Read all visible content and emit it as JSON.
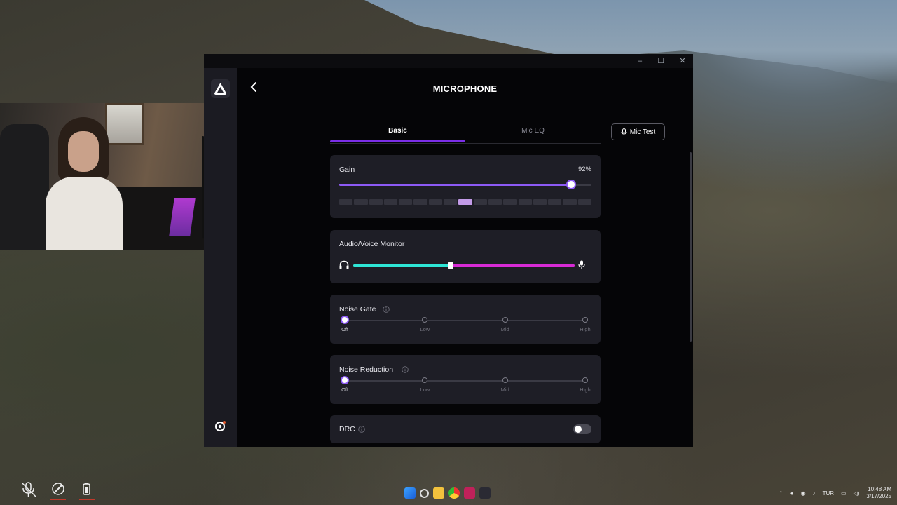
{
  "app": {
    "page_title": "MICROPHONE",
    "window_controls": {
      "minimize": "–",
      "maximize": "☐",
      "close": "✕"
    }
  },
  "tabs": [
    {
      "label": "Basic",
      "active": true
    },
    {
      "label": "Mic EQ",
      "active": false
    }
  ],
  "mic_test_label": "Mic Test",
  "gain": {
    "label": "Gain",
    "value_text": "92%",
    "value": 0.92,
    "meter_segments": 17,
    "meter_lit_index": 8
  },
  "monitor": {
    "label": "Audio/Voice Monitor",
    "mix": 0.44,
    "left_icon": "headphones-icon",
    "right_icon": "microphone-icon"
  },
  "noise_gate": {
    "label": "Noise Gate",
    "options": [
      "Off",
      "Low",
      "Mid",
      "High"
    ],
    "selected": 0
  },
  "noise_reduction": {
    "label": "Noise Reduction",
    "options": [
      "Off",
      "Low",
      "Mid",
      "High"
    ],
    "selected": 0
  },
  "drc": {
    "label": "DRC",
    "enabled": false
  },
  "colors": {
    "accent": "#7b2ee8",
    "slider_purple": "#8d5af5",
    "monitor_cyan": "#2ee6d6",
    "monitor_magenta": "#d82bd6"
  },
  "taskbar": {
    "language": "TUR",
    "time": "10:48 AM",
    "date": "3/17/2025"
  }
}
